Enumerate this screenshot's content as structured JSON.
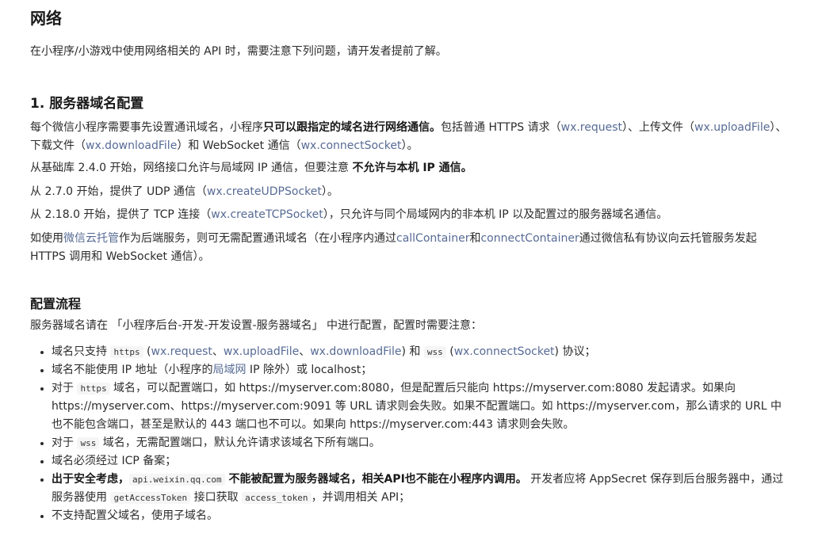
{
  "page": {
    "title": "网络",
    "intro": "在小程序/小游戏中使用网络相关的 API 时，需要注意下列问题，请开发者提前了解。"
  },
  "section1": {
    "heading": "1. 服务器域名配置",
    "p1": {
      "a": "每个微信小程序需要事先设置通讯域名，小程序",
      "b": "只可以跟指定的域名进行网络通信。",
      "c": "包括普通 HTTPS 请求（",
      "link1": "wx.request",
      "d": "）、上传文件（",
      "link2": "wx.uploadFile",
      "e": "）、下载文件（",
      "link3": "wx.downloadFile",
      "f": "）和 WebSocket 通信（",
      "link4": "wx.connectSocket",
      "g": "）。"
    },
    "p2": {
      "a": "从基础库 2.4.0 开始，网络接口允许与局域网 IP 通信，但要注意 ",
      "b": "不允许与本机 IP 通信。"
    },
    "p3": {
      "a": "从 2.7.0 开始，提供了 UDP 通信（",
      "link": "wx.createUDPSocket",
      "b": "）。"
    },
    "p4": {
      "a": "从 2.18.0 开始，提供了 TCP 连接（",
      "link": "wx.createTCPSocket",
      "b": "），只允许与同个局域网内的非本机 IP 以及配置过的服务器域名通信。"
    },
    "p5": {
      "a": "如使用",
      "link1": "微信云托管",
      "b": "作为后端服务，则可无需配置通讯域名（在小程序内通过",
      "link2": "callContainer",
      "c": "和",
      "link3": "connectContainer",
      "d": "通过微信私有协议向云托管服务发起 HTTPS 调用和 WebSocket 通信）。"
    }
  },
  "section2": {
    "heading": "配置流程",
    "intro": "服务器域名请在 「小程序后台-开发-开发设置-服务器域名」 中进行配置，配置时需要注意：",
    "items": [
      {
        "a": "域名只支持 ",
        "code1": "https",
        "b": " (",
        "l1": "wx.request",
        "s1": "、",
        "l2": "wx.uploadFile",
        "s2": "、",
        "l3": "wx.downloadFile",
        "c": ") 和 ",
        "code2": "wss",
        "d": " (",
        "l4": "wx.connectSocket",
        "e": ") 协议；"
      },
      {
        "a": "域名不能使用 IP 地址（小程序的",
        "link": "局域网",
        "b": " IP 除外）或 localhost；"
      },
      {
        "a": "对于 ",
        "code": "https",
        "b": " 域名，可以配置端口，如 https://myserver.com:8080，但是配置后只能向 https://myserver.com:8080 发起请求。如果向 https://myserver.com、https://myserver.com:9091 等 URL 请求则会失败。如果不配置端口。如 https://myserver.com，那么请求的 URL 中也不能包含端口，甚至是默认的 443 端口也不可以。如果向 https://myserver.com:443 请求则会失败。"
      },
      {
        "a": "对于 ",
        "code": "wss",
        "b": " 域名，无需配置端口，默认允许请求该域名下所有端口。"
      },
      {
        "a": "域名必须经过 ICP 备案；"
      },
      {
        "bold1": "出于安全考虑，",
        "code1": "api.weixin.qq.com",
        "bold2": " 不能被配置为服务器域名，相关API也不能在小程序内调用。",
        "a": " 开发者应将 AppSecret 保存到后台服务器中，通过服务器使用 ",
        "code2": "getAccessToken",
        "b": " 接口获取 ",
        "code3": "access_token",
        "c": "，并调用相关 API；"
      },
      {
        "a": "不支持配置父域名，使用子域名。"
      }
    ]
  },
  "colors": {
    "link": "#576b95",
    "text": "#2b2b2b",
    "code_bg": "#f5f5f5"
  }
}
